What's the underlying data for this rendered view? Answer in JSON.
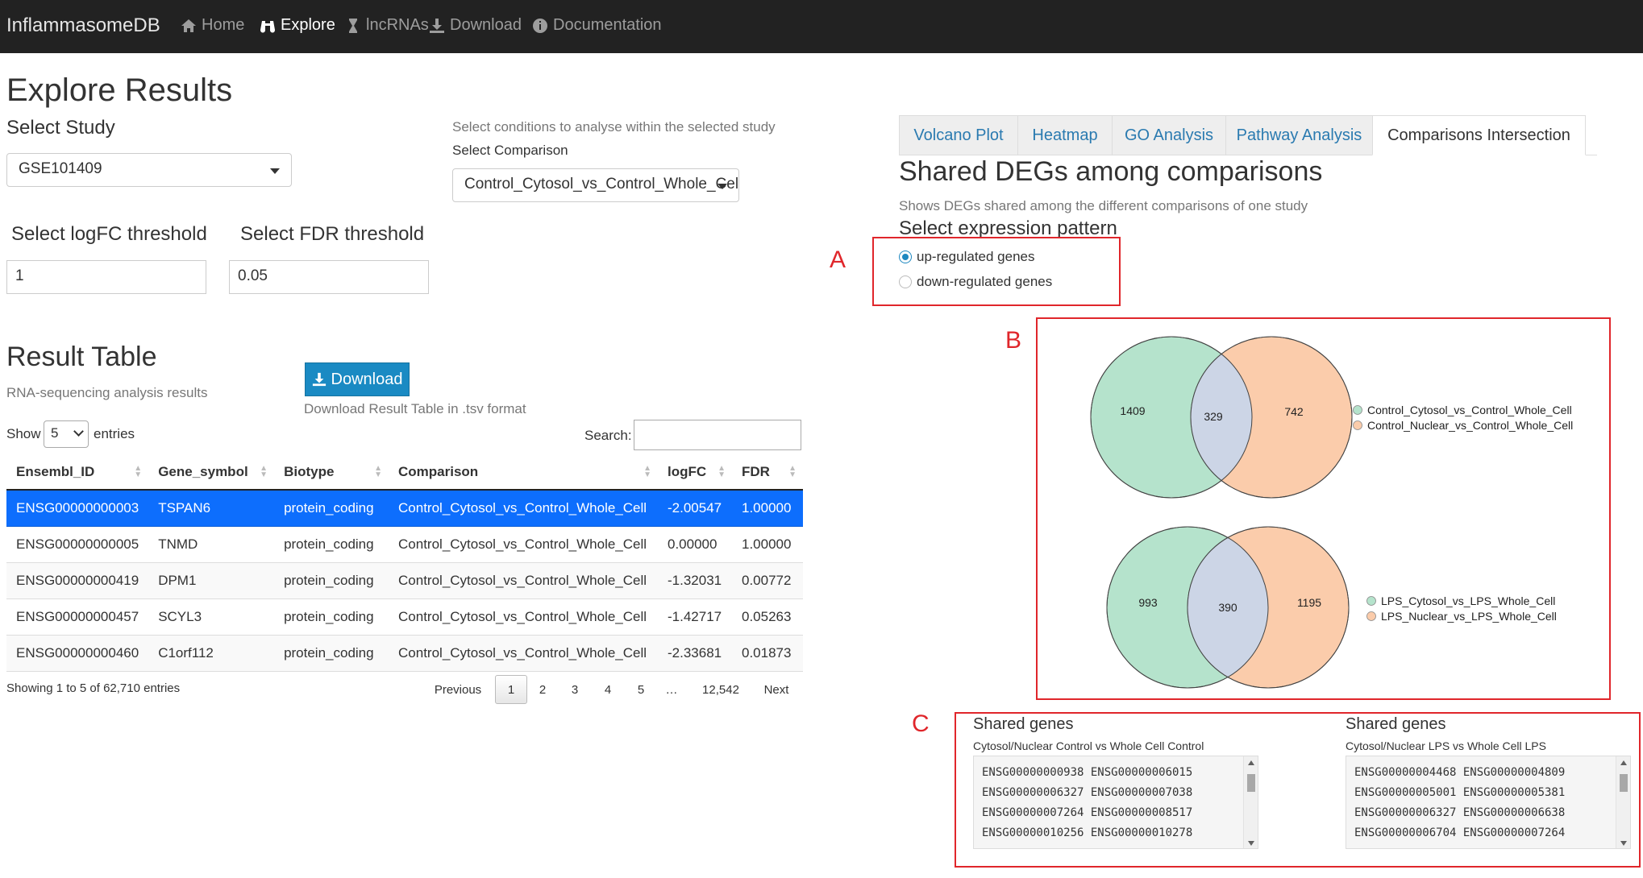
{
  "navbar": {
    "brand": "InflammasomeDB",
    "items": [
      {
        "label": "Home",
        "icon": "home-icon"
      },
      {
        "label": "Explore",
        "icon": "binoculars-icon"
      },
      {
        "label": "lncRNAs",
        "icon": "hourglass-icon"
      },
      {
        "label": "Download",
        "icon": "download-icon"
      },
      {
        "label": "Documentation",
        "icon": "info-circle-icon"
      }
    ]
  },
  "explore": {
    "title": "Explore Results",
    "select_study_label": "Select Study",
    "study_value": "GSE101409",
    "conditions_hint": "Select conditions to analyse within the selected study",
    "select_comparison_label": "Select Comparison",
    "comparison_value": "Control_Cytosol_vs_Control_Whole_Cel",
    "logfc_label": "Select logFC threshold",
    "logfc_value": "1",
    "fdr_label": "Select FDR threshold",
    "fdr_value": "0.05"
  },
  "result": {
    "title": "Result Table",
    "subtitle": "RNA-sequencing analysis results",
    "download_label": "Download",
    "download_hint": "Download Result Table in .tsv format",
    "show_label": "Show",
    "entries_label": "entries",
    "page_length": "5",
    "search_label": "Search:",
    "columns": [
      "Ensembl_ID",
      "Gene_symbol",
      "Biotype",
      "Comparison",
      "logFC",
      "FDR"
    ],
    "rows": [
      [
        "ENSG00000000003",
        "TSPAN6",
        "protein_coding",
        "Control_Cytosol_vs_Control_Whole_Cell",
        "-2.00547",
        "1.00000"
      ],
      [
        "ENSG00000000005",
        "TNMD",
        "protein_coding",
        "Control_Cytosol_vs_Control_Whole_Cell",
        "0.00000",
        "1.00000"
      ],
      [
        "ENSG00000000419",
        "DPM1",
        "protein_coding",
        "Control_Cytosol_vs_Control_Whole_Cell",
        "-1.32031",
        "0.00772"
      ],
      [
        "ENSG00000000457",
        "SCYL3",
        "protein_coding",
        "Control_Cytosol_vs_Control_Whole_Cell",
        "-1.42717",
        "0.05263"
      ],
      [
        "ENSG00000000460",
        "C1orf112",
        "protein_coding",
        "Control_Cytosol_vs_Control_Whole_Cell",
        "-2.33681",
        "0.01873"
      ]
    ],
    "info": "Showing 1 to 5 of 62,710 entries",
    "pagination": {
      "previous": "Previous",
      "pages": [
        "1",
        "2",
        "3",
        "4",
        "5",
        "…",
        "12,542"
      ],
      "next": "Next",
      "current": "1"
    }
  },
  "tabs": [
    "Volcano Plot",
    "Heatmap",
    "GO Analysis",
    "Pathway Analysis",
    "Comparisons Intersection"
  ],
  "active_tab": "Comparisons Intersection",
  "shared": {
    "title": "Shared DEGs among comparisons",
    "subtitle": "Shows DEGs shared among the different comparisons of one study",
    "pattern_label": "Select expression pattern",
    "options": [
      "up-regulated genes",
      "down-regulated genes"
    ],
    "selected_option": "up-regulated genes"
  },
  "annotations": {
    "a": "A",
    "b": "B",
    "c": "C",
    "color": "#e0262b"
  },
  "venn": [
    {
      "left_only": "1409",
      "shared": "329",
      "right_only": "742",
      "legend": [
        "Control_Cytosol_vs_Control_Whole_Cell",
        "Control_Nuclear_vs_Control_Whole_Cell"
      ]
    },
    {
      "left_only": "993",
      "shared": "390",
      "right_only": "1195",
      "legend": [
        "LPS_Cytosol_vs_LPS_Whole_Cell",
        "LPS_Nuclear_vs_LPS_Whole_Cell"
      ]
    }
  ],
  "venn_colors": {
    "left": "#b5e3cc",
    "right": "#fbccab",
    "overlap": "#ccd5e6"
  },
  "shared_genes": [
    {
      "title": "Shared genes",
      "subtitle": "Cytosol/Nuclear Control vs Whole Cell Control",
      "lines": [
        "ENSG00000000938 ENSG00000006015",
        "ENSG00000006327 ENSG00000007038",
        "ENSG00000007264 ENSG00000008517",
        "ENSG00000010256 ENSG00000010278"
      ]
    },
    {
      "title": "Shared genes",
      "subtitle": "Cytosol/Nuclear LPS vs Whole Cell LPS",
      "lines": [
        "ENSG00000004468 ENSG00000004809",
        "ENSG00000005001 ENSG00000005381",
        "ENSG00000006327 ENSG00000006638",
        "ENSG00000006704 ENSG00000007264"
      ]
    }
  ]
}
